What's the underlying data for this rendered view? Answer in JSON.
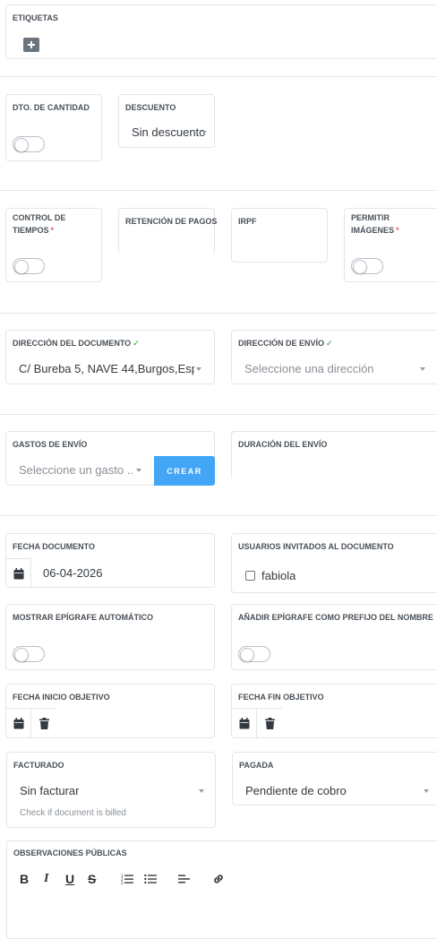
{
  "etiquetas": {
    "label": "ETIQUETAS"
  },
  "dto_cantidad": {
    "label": "DTO. DE CANTIDAD"
  },
  "descuento": {
    "label": "DESCUENTO",
    "value": "Sin descuento"
  },
  "control_tiempos": {
    "label": "CONTROL DE TIEMPOS",
    "required": "*"
  },
  "retencion_pagos": {
    "label": "RETENCIÓN DE PAGOS"
  },
  "irpf": {
    "label": "IRPF"
  },
  "permitir_imagenes": {
    "label": "PERMITIR IMÁGENES",
    "required": "*"
  },
  "direccion_documento": {
    "label": "DIRECCIÓN DEL DOCUMENTO",
    "check": "✓",
    "value": "C/ Bureba 5, NAVE 44,Burgos,Esp..."
  },
  "direccion_envio": {
    "label": "DIRECCIÓN DE ENVÍO",
    "check": "✓",
    "placeholder": "Seleccione una dirección"
  },
  "gastos_envio": {
    "label": "GASTOS DE ENVÍO",
    "placeholder": "Seleccione un gasto ...",
    "button": "CREAR"
  },
  "duracion_envio": {
    "label": "DURACIÓN DEL ENVÍO"
  },
  "fecha_documento": {
    "label": "FECHA DOCUMENTO",
    "value": "06-04-2026"
  },
  "usuarios_invitados": {
    "label": "USUARIOS INVITADOS AL DOCUMENTO",
    "user": "fabiola"
  },
  "mostrar_epigrafe": {
    "label": "MOSTRAR EPÍGRAFE AUTOMÁTICO"
  },
  "anadir_epigrafe": {
    "label": "AÑADIR EPÍGRAFE COMO PREFIJO DEL NOMBRE"
  },
  "fecha_inicio": {
    "label": "FECHA INICIO OBJETIVO"
  },
  "fecha_fin": {
    "label": "FECHA FIN OBJETIVO"
  },
  "facturado": {
    "label": "FACTURADO",
    "value": "Sin facturar",
    "help": "Check if document is billed"
  },
  "pagada": {
    "label": "PAGADA",
    "value": "Pendiente de cobro"
  },
  "observaciones": {
    "label": "OBSERVACIONES PÚBLICAS",
    "toolbar": {
      "bold": "B",
      "italic": "I",
      "underline": "U",
      "strike": "S"
    }
  },
  "colors": {
    "accent": "#42a5f5",
    "check": "#5cb85c",
    "required": "#e4606d",
    "border": "#e3e6ea"
  }
}
